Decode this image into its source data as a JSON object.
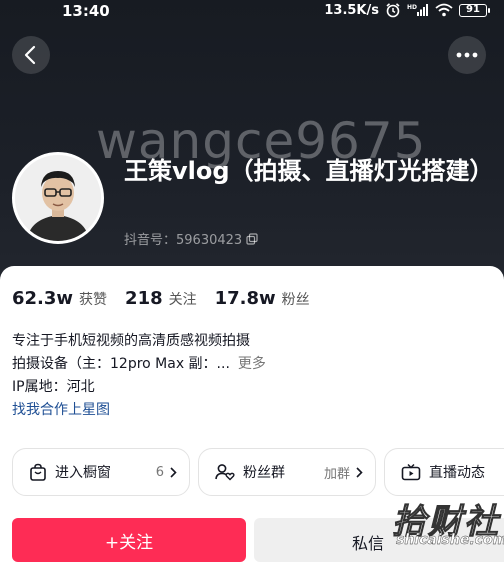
{
  "status_bar": {
    "time": "13:40",
    "network_speed": "13.5K/s",
    "battery": "91",
    "icons": [
      "alarm-icon",
      "hd-signal-icon",
      "wifi-icon",
      "battery-icon"
    ]
  },
  "header": {
    "back_icon": "back-chevron-icon",
    "more_icon": "more-dots-icon",
    "watermark_text": "wangce9675",
    "name": "王策vlog（拍摄、直播灯光搭建）",
    "douyin_id": "抖音号：59630423",
    "copy_icon": "copy-icon"
  },
  "stats": [
    {
      "value": "62.3w",
      "label": "获赞"
    },
    {
      "value": "218",
      "label": "关注"
    },
    {
      "value": "17.8w",
      "label": "粉丝"
    }
  ],
  "bio": {
    "line1": "专注于手机短视频的高清质感视频拍摄",
    "line2": "拍摄设备（主：12pro Max 副：...",
    "more": "更多",
    "line3": "IP属地：河北",
    "link": "找我合作上星图"
  },
  "quick_actions": [
    {
      "icon": "shopping-bag-icon",
      "label": "进入橱窗",
      "right": "6"
    },
    {
      "icon": "fans-group-icon",
      "label": "粉丝群",
      "right": "加群"
    },
    {
      "icon": "live-tv-icon",
      "label": "直播动态",
      "right": ""
    }
  ],
  "buttons": {
    "follow": "+关注",
    "message": "私信"
  },
  "site_mark": {
    "cn": "拾财社",
    "en": "shicaishe.com"
  },
  "colors": {
    "follow_red": "#fe2c55",
    "link_blue": "#1f4f94",
    "header_dark": "#1c2028"
  }
}
